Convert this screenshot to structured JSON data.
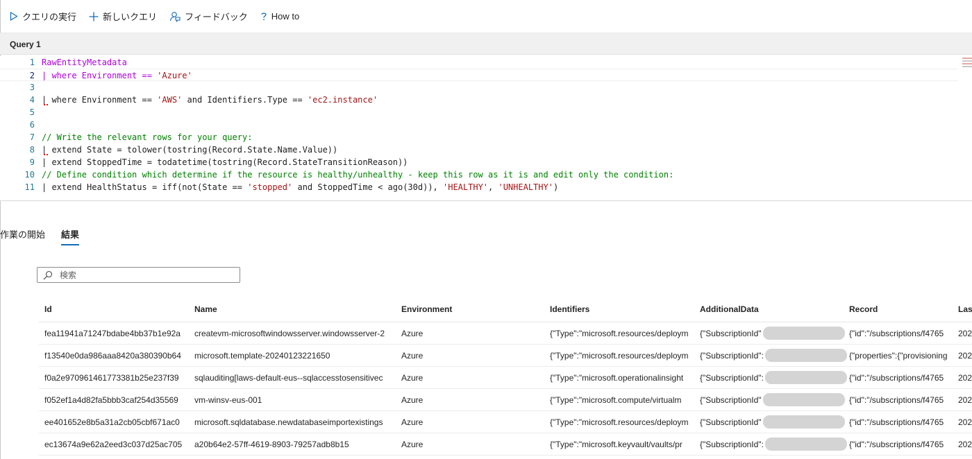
{
  "toolbar": {
    "run_label": "クエリの実行",
    "new_query_label": "新しいクエリ",
    "feedback_label": "フィードバック",
    "howto_label": "How to",
    "icons": [
      "play-icon",
      "plus-icon",
      "feedback-icon",
      "help-icon"
    ],
    "accent": "#0f6cbd"
  },
  "query_tab": {
    "label": "Query 1"
  },
  "editor": {
    "lines": [
      {
        "n": "1",
        "parts": [
          {
            "t": "RawEntityMetadata",
            "c": "kw-table"
          }
        ]
      },
      {
        "n": "2",
        "parts": [
          {
            "t": "| where Environment == ",
            "c": "kw-table"
          },
          {
            "t": "'Azure'",
            "c": "kw-str"
          }
        ]
      },
      {
        "n": "3",
        "parts": []
      },
      {
        "n": "4",
        "parts": [
          {
            "t": "| where Environment == ",
            "c": ""
          },
          {
            "t": "'AWS'",
            "c": "kw-str"
          },
          {
            "t": " and Identifiers.Type == ",
            "c": ""
          },
          {
            "t": "'ec2.instance'",
            "c": "kw-str"
          }
        ]
      },
      {
        "n": "5",
        "parts": []
      },
      {
        "n": "6",
        "parts": []
      },
      {
        "n": "7",
        "parts": [
          {
            "t": "// Write the relevant rows for your query:",
            "c": "kw-comment"
          }
        ]
      },
      {
        "n": "8",
        "parts": [
          {
            "t": "| extend State = tolower(tostring(Record.State.Name.Value))",
            "c": ""
          }
        ]
      },
      {
        "n": "9",
        "parts": [
          {
            "t": "| extend StoppedTime = todatetime(tostring(Record.StateTransitionReason))",
            "c": ""
          }
        ]
      },
      {
        "n": "10",
        "parts": [
          {
            "t": "// Define condition which determine if the resource is healthy/unhealthy - keep this row as it is and edit only the condition:",
            "c": "kw-comment"
          }
        ]
      },
      {
        "n": "11",
        "parts": [
          {
            "t": "| extend HealthStatus = iff(not(State == ",
            "c": ""
          },
          {
            "t": "'stopped'",
            "c": "kw-str"
          },
          {
            "t": " and StoppedTime < ago(30d)), ",
            "c": ""
          },
          {
            "t": "'HEALTHY'",
            "c": "kw-str"
          },
          {
            "t": ", ",
            "c": ""
          },
          {
            "t": "'UNHEALTHY'",
            "c": "kw-str"
          },
          {
            "t": ")",
            "c": ""
          }
        ]
      }
    ]
  },
  "result_tabs": {
    "start_label": "作業の開始",
    "results_label": "結果"
  },
  "search": {
    "placeholder": "検索",
    "value": ""
  },
  "grid": {
    "columns": [
      "Id",
      "Name",
      "Environment",
      "Identifiers",
      "AdditionalData",
      "Record",
      "Las"
    ],
    "rows": [
      [
        "fea11941a71247bdabe4bb37b1e92a",
        "createvm-microsoftwindowsserver.windowsserver-2",
        "Azure",
        "{\"Type\":\"microsoft.resources/deploym",
        "{\"SubscriptionId\"",
        "{\"id\":\"/subscriptions/f4765",
        "202"
      ],
      [
        "f13540e0da986aaa8420a380390b64",
        "microsoft.template-20240123221650",
        "Azure",
        "{\"Type\":\"microsoft.resources/deploym",
        "{\"SubscriptionId\":",
        "{\"properties\":{\"provisioning",
        "202"
      ],
      [
        "f0a2e970961461773381b25e237f39",
        "sqlauditing[laws-default-eus--sqlaccesstosensitivec",
        "Azure",
        "{\"Type\":\"microsoft.operationalinsight",
        "{\"SubscriptionId\":",
        "{\"id\":\"/subscriptions/f4765",
        "202"
      ],
      [
        "f052ef1a4d82fa5bbb3caf254d35569",
        "vm-winsv-eus-001",
        "Azure",
        "{\"Type\":\"microsoft.compute/virtualm",
        "{\"SubscriptionId\"",
        "{\"id\":\"/subscriptions/f4765",
        "202"
      ],
      [
        "ee401652e8b5a31a2cb05cbf671ac0",
        "microsoft.sqldatabase.newdatabaseimportexistings",
        "Azure",
        "{\"Type\":\"microsoft.resources/deploym",
        "{\"SubscriptionId\"",
        "{\"id\":\"/subscriptions/f4765",
        "202"
      ],
      [
        "ec13674a9e62a2eed3c037d25ac705",
        "a20b64e2-57ff-4619-8903-79257adb8b15",
        "Azure",
        "{\"Type\":\"microsoft.keyvault/vaults/pr",
        "{\"SubscriptionId\":",
        "{\"id\":\"/subscriptions/f4765",
        "202"
      ]
    ]
  }
}
